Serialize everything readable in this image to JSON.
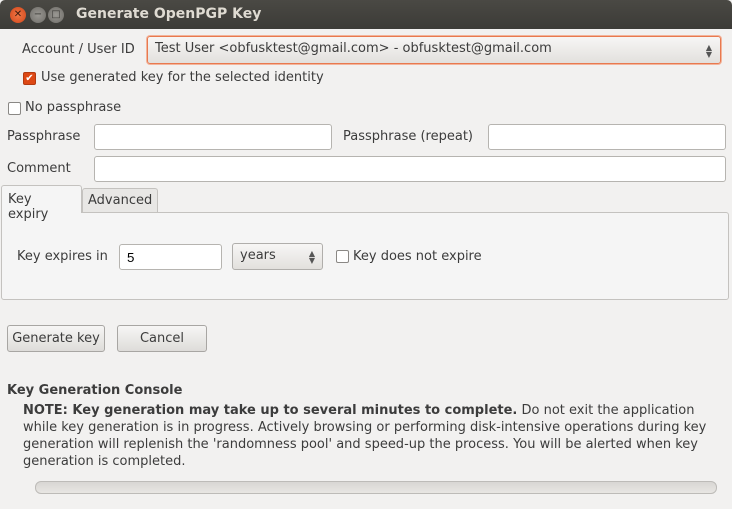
{
  "window": {
    "title": "Generate OpenPGP Key"
  },
  "account": {
    "label": "Account / User ID",
    "value": "Test User <obfusktest@gmail.com> - obfusktest@gmail.com"
  },
  "use_generated": {
    "label": "Use generated key for the selected identity",
    "checked": true
  },
  "no_passphrase": {
    "label": "No passphrase",
    "checked": false
  },
  "passphrase": {
    "label": "Passphrase",
    "value": ""
  },
  "passphrase_repeat": {
    "label": "Passphrase (repeat)",
    "value": ""
  },
  "comment": {
    "label": "Comment",
    "value": ""
  },
  "tabs": [
    {
      "label": "Key expiry",
      "active": true
    },
    {
      "label": "Advanced",
      "active": false
    }
  ],
  "expiry": {
    "label": "Key expires in",
    "value": "5",
    "unit": "years",
    "no_expire_label": "Key does not expire",
    "no_expire_checked": false
  },
  "buttons": {
    "generate": "Generate key",
    "cancel": "Cancel"
  },
  "console": {
    "heading": "Key Generation Console",
    "note_bold": "NOTE: Key generation may take up to several minutes to complete.",
    "note_rest": " Do not exit the application while key generation is in progress. Actively browsing or performing disk-intensive operations during key generation will replenish the 'randomness pool' and speed-up the process. You will be alerted when key generation is completed.",
    "progress": 0
  },
  "colors": {
    "accent": "#dd4814"
  }
}
